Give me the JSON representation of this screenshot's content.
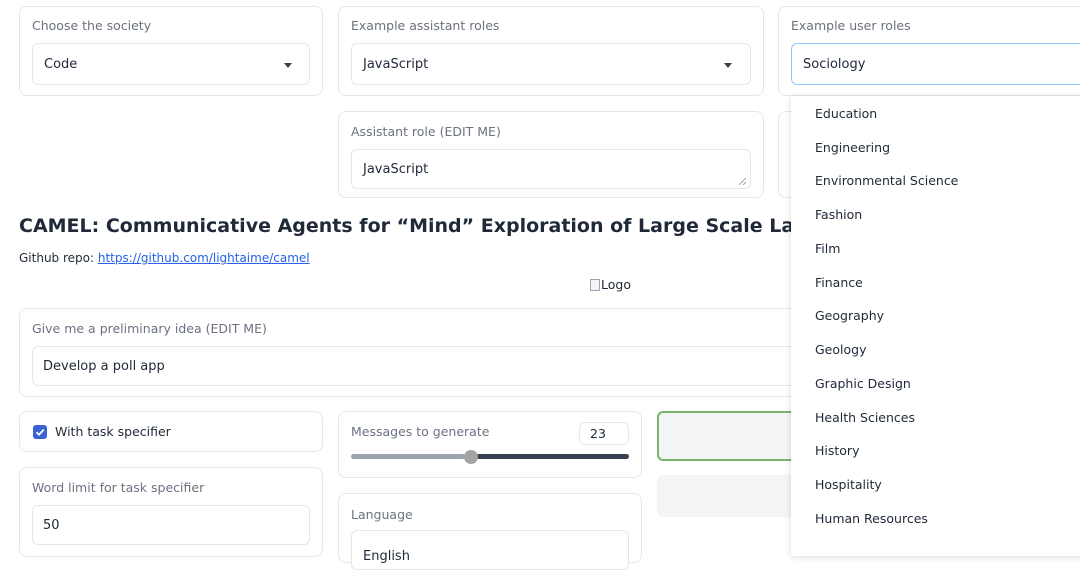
{
  "society": {
    "label": "Choose the society",
    "value": "Code"
  },
  "assistant_roles": {
    "label": "Example assistant roles",
    "value": "JavaScript"
  },
  "user_roles": {
    "label": "Example user roles",
    "value": "Sociology",
    "options": [
      "Education",
      "Engineering",
      "Environmental Science",
      "Fashion",
      "Film",
      "Finance",
      "Geography",
      "Geology",
      "Graphic Design",
      "Health Sciences",
      "History",
      "Hospitality",
      "Human Resources"
    ]
  },
  "assistant_role": {
    "label": "Assistant role (EDIT ME)",
    "value": "JavaScript"
  },
  "title": "CAMEL: Communicative Agents for “Mind” Exploration of Large Scale Language Model S",
  "github": {
    "prefix": "Github repo:",
    "link": "https://github.com/lightaime/camel"
  },
  "logo_alt": "Logo",
  "idea": {
    "label": "Give me a preliminary idea (EDIT ME)",
    "value": "Develop a poll app"
  },
  "task_specifier": {
    "label": "With task specifier",
    "checked": true
  },
  "word_limit": {
    "label": "Word limit for task specifier",
    "value": "50"
  },
  "messages": {
    "label": "Messages to generate",
    "value": "23",
    "slider_fraction": 0.41
  },
  "language": {
    "label": "Language",
    "value": "English"
  },
  "colors": {
    "accent": "#3b63d4",
    "link": "#2563eb",
    "focus_green": "#7ab36c",
    "focus_blue": "#93c5fd"
  }
}
